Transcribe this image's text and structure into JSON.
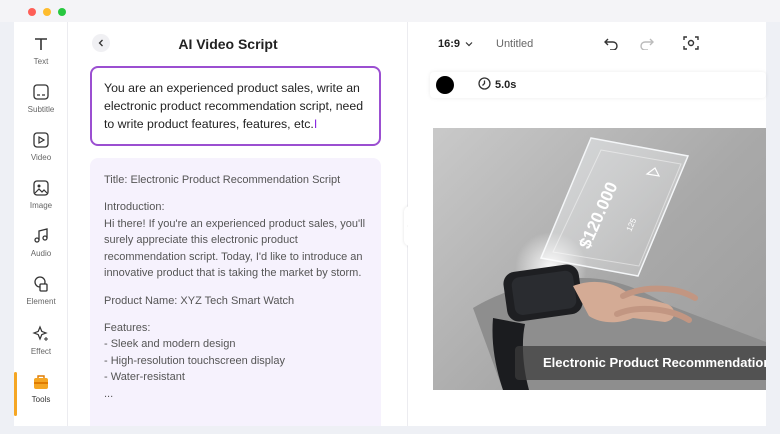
{
  "rail": {
    "items": [
      {
        "label": "Text",
        "icon": "text-icon"
      },
      {
        "label": "Subtitle",
        "icon": "subtitle-icon"
      },
      {
        "label": "Video",
        "icon": "video-icon"
      },
      {
        "label": "Image",
        "icon": "image-icon"
      },
      {
        "label": "Audio",
        "icon": "audio-icon"
      },
      {
        "label": "Element",
        "icon": "element-icon"
      },
      {
        "label": "Effect",
        "icon": "effect-icon"
      },
      {
        "label": "Tools",
        "icon": "toolbox-icon",
        "active": true
      }
    ]
  },
  "panel": {
    "title": "AI Video Script",
    "prompt": "You are an experienced product sales, write an electronic product recommendation script, need to write product features, features, etc.",
    "result": {
      "title_line": "Title: Electronic Product Recommendation Script",
      "intro_heading": "Introduction:",
      "intro_text": "Hi there! If you're an experienced product sales, you'll surely appreciate this electronic product recommendation script. Today, I'd like to introduce an innovative product that is taking the market by storm.",
      "product_name": "Product Name: XYZ Tech Smart Watch",
      "features_heading": "Features:",
      "features": [
        "- Sleek and modern design",
        "- High-resolution touchscreen display",
        "- Water-resistant"
      ],
      "more": "..."
    }
  },
  "editor": {
    "aspect_ratio": "16:9",
    "doc_title": "Untitled",
    "duration": "5.0s",
    "text_color": "#000000",
    "caption": "Electronic Product Recommendation",
    "hologram_price": "$120.000",
    "hologram_sub": "125"
  },
  "colors": {
    "accent_purple": "#9b4fd1",
    "tools_orange": "#f5a623",
    "result_bg": "#f6f2fd"
  }
}
